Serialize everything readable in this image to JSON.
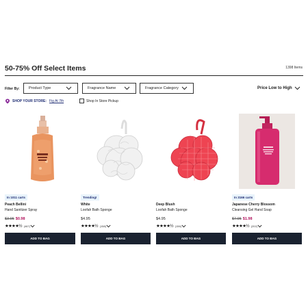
{
  "header": {
    "title": "50-75% Off Select Items",
    "item_count": "1398 Items"
  },
  "filters": {
    "label": "Filter By:",
    "dropdowns": [
      "Product Type",
      "Fragrance Name",
      "Fragrance Category"
    ],
    "sort_label": "Price Low to High"
  },
  "store": {
    "label": "SHOP YOUR STORE:",
    "name": "Fig At 7th",
    "pickup_label": "Shop In Store Pickup"
  },
  "products": [
    {
      "badge": "In 1011 carts",
      "name": "Peach Bellini",
      "type": "Hand Sanitizer Spray",
      "old_price": "$3.95",
      "price": "$0.98",
      "stars": "★★★★½",
      "reviews": "(467)",
      "button": "ADD TO BAG"
    },
    {
      "badge": "Trending!",
      "name": "White",
      "type": "Loofah Bath Sponge",
      "old_price": "",
      "price": "$4.95",
      "stars": "★★★★½",
      "reviews": "(158)",
      "button": "ADD TO BAG"
    },
    {
      "badge": "",
      "name": "Deep Blush",
      "type": "Loofah Bath Sponge",
      "old_price": "",
      "price": "$4.95",
      "stars": "★★★★½",
      "reviews": "(156)",
      "button": "ADD TO BAG"
    },
    {
      "badge": "In 3166 carts",
      "name": "Japanese Cherry Blossom",
      "type": "Cleansing Gel Hand Soap",
      "old_price": "$7.95",
      "price": "$1.98",
      "stars": "★★★★½",
      "reviews": "(202)",
      "button": "ADD TO BAG"
    }
  ],
  "colors": {
    "accent": "#1f2d73",
    "sale": "#b2135d",
    "button": "#1a2230",
    "badge_bg": "#e8f3fb"
  }
}
